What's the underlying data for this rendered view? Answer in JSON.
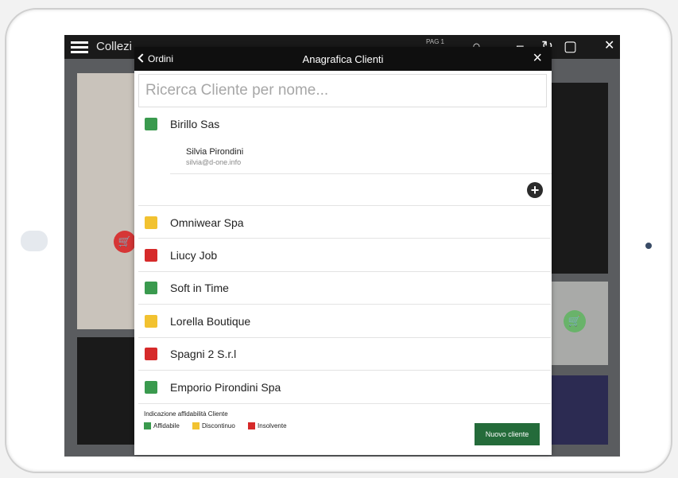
{
  "background_app": {
    "title": "Collezi",
    "page_indicator": "PAG 1"
  },
  "modal": {
    "back_label": "Ordini",
    "title": "Anagrafica Clienti",
    "search_placeholder": "Ricerca Cliente per nome...",
    "clients": [
      {
        "name": "Birillo Sas",
        "status": "affidabile"
      },
      {
        "name": "Omniwear Spa",
        "status": "discontinuo"
      },
      {
        "name": "Liucy Job",
        "status": "insolvente"
      },
      {
        "name": "Soft in Time",
        "status": "affidabile"
      },
      {
        "name": "Lorella Boutique",
        "status": "discontinuo"
      },
      {
        "name": "Spagni 2 S.r.l",
        "status": "insolvente"
      },
      {
        "name": "Emporio Pirondini Spa",
        "status": "affidabile"
      }
    ],
    "expanded_contact": {
      "name": "Silvia Pirondini",
      "email": "silvia@d-one.info"
    },
    "legend": {
      "title": "Indicazione affidabilità Cliente",
      "items": [
        {
          "label": "Affidabile",
          "color": "#3a9a4e"
        },
        {
          "label": "Discontinuo",
          "color": "#f2c230"
        },
        {
          "label": "Insolvente",
          "color": "#d62a2a"
        }
      ]
    },
    "new_client_label": "Nuovo cliente"
  },
  "colors": {
    "affidabile": "#3a9a4e",
    "discontinuo": "#f2c230",
    "insolvente": "#d62a2a",
    "primary_button": "#246b3a"
  }
}
